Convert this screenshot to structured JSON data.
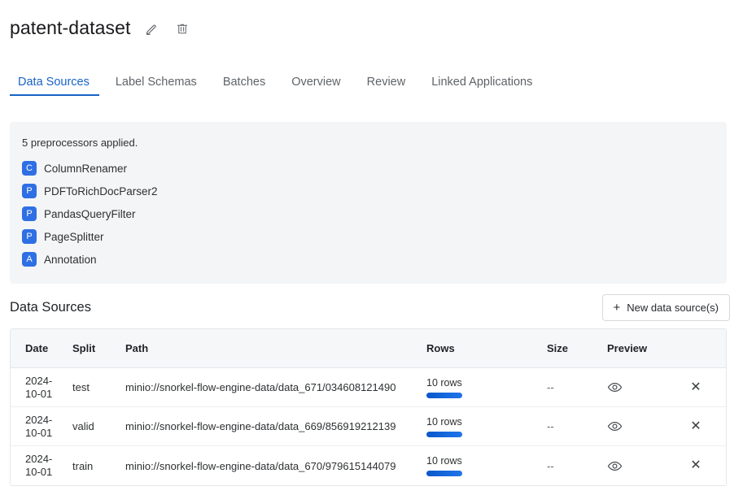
{
  "header": {
    "title": "patent-dataset",
    "edit_icon": "pencil-icon",
    "delete_icon": "trash-icon"
  },
  "tabs": [
    {
      "label": "Data Sources",
      "active": true
    },
    {
      "label": "Label Schemas",
      "active": false
    },
    {
      "label": "Batches",
      "active": false
    },
    {
      "label": "Overview",
      "active": false
    },
    {
      "label": "Review",
      "active": false
    },
    {
      "label": "Linked Applications",
      "active": false
    }
  ],
  "preprocessors": {
    "summary": "5 preprocessors applied.",
    "items": [
      {
        "badge": "C",
        "name": "ColumnRenamer"
      },
      {
        "badge": "P",
        "name": "PDFToRichDocParser2"
      },
      {
        "badge": "P",
        "name": "PandasQueryFilter"
      },
      {
        "badge": "P",
        "name": "PageSplitter"
      },
      {
        "badge": "A",
        "name": "Annotation"
      }
    ]
  },
  "data_sources": {
    "section_title": "Data Sources",
    "new_button_label": "New data source(s)",
    "new_button_icon": "plus-icon",
    "columns": [
      "Date",
      "Split",
      "Path",
      "Rows",
      "Size",
      "Preview",
      ""
    ],
    "rows": [
      {
        "date_line1": "2024-",
        "date_line2": "10-01",
        "split": "test",
        "path": "minio://snorkel-flow-engine-data/data_671/034608121490",
        "rows": "10 rows",
        "size": "--",
        "preview_icon": "eye-icon",
        "remove_icon": "close-icon"
      },
      {
        "date_line1": "2024-",
        "date_line2": "10-01",
        "split": "valid",
        "path": "minio://snorkel-flow-engine-data/data_669/856919212139",
        "rows": "10 rows",
        "size": "--",
        "preview_icon": "eye-icon",
        "remove_icon": "close-icon"
      },
      {
        "date_line1": "2024-",
        "date_line2": "10-01",
        "split": "train",
        "path": "minio://snorkel-flow-engine-data/data_670/979615144079",
        "rows": "10 rows",
        "size": "--",
        "preview_icon": "eye-icon",
        "remove_icon": "close-icon"
      }
    ]
  },
  "colors": {
    "accent": "#1763c6",
    "badge": "#2f6fe4",
    "progress": "#1668dd",
    "panel_bg": "#f4f5f7",
    "table_head_bg": "#f5f7f9"
  }
}
